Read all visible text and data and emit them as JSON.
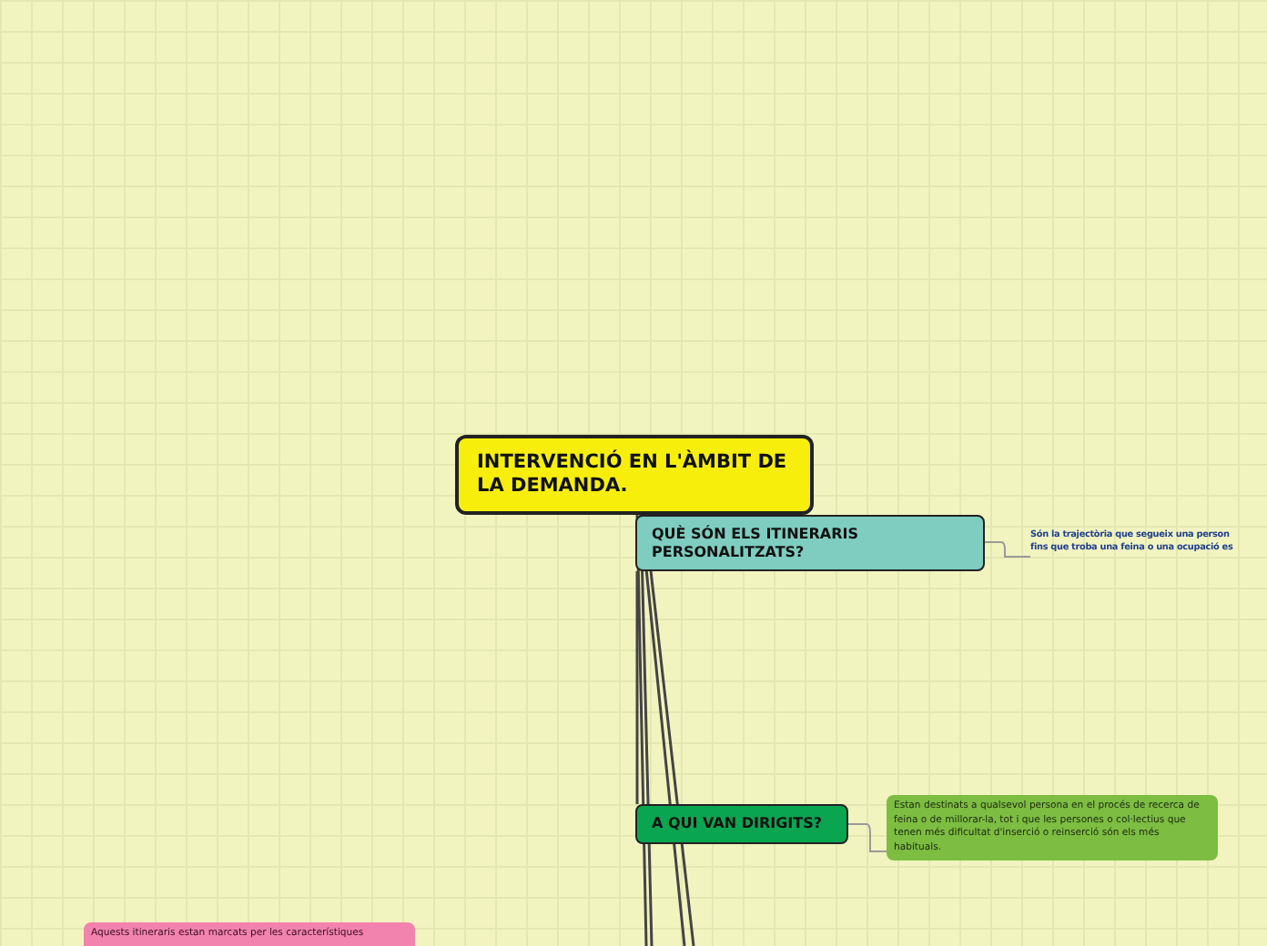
{
  "central_topic": {
    "title": "INTERVENCIÓ EN L'ÀMBIT DE LA DEMANDA."
  },
  "topics": [
    {
      "title": "QUÈ SÓN ELS ITINERARIS PERSONALITZATS?",
      "color": "#7ecdc0",
      "note": {
        "kind": "plain",
        "lines": [
          "Són la trajectòria que segueix una person",
          "fins que troba una feina o una ocupació es"
        ]
      }
    },
    {
      "title": "A QUI VAN DIRIGITS?",
      "color": "#0aa551",
      "note": {
        "kind": "boxed",
        "color": "#7cbd42",
        "lines": [
          "Estan destinats a qualsevol persona en el procés de recerca de",
          "feina o de millorar-la, tot i que les persones o col·lectius que",
          "tenen més dificultat d'inserció o reinserció són els més",
          "habituals."
        ]
      }
    }
  ],
  "floating_note": {
    "color": "#f283ae",
    "lines": [
      "Aquests itineraris estan marcats per les característiques"
    ]
  }
}
